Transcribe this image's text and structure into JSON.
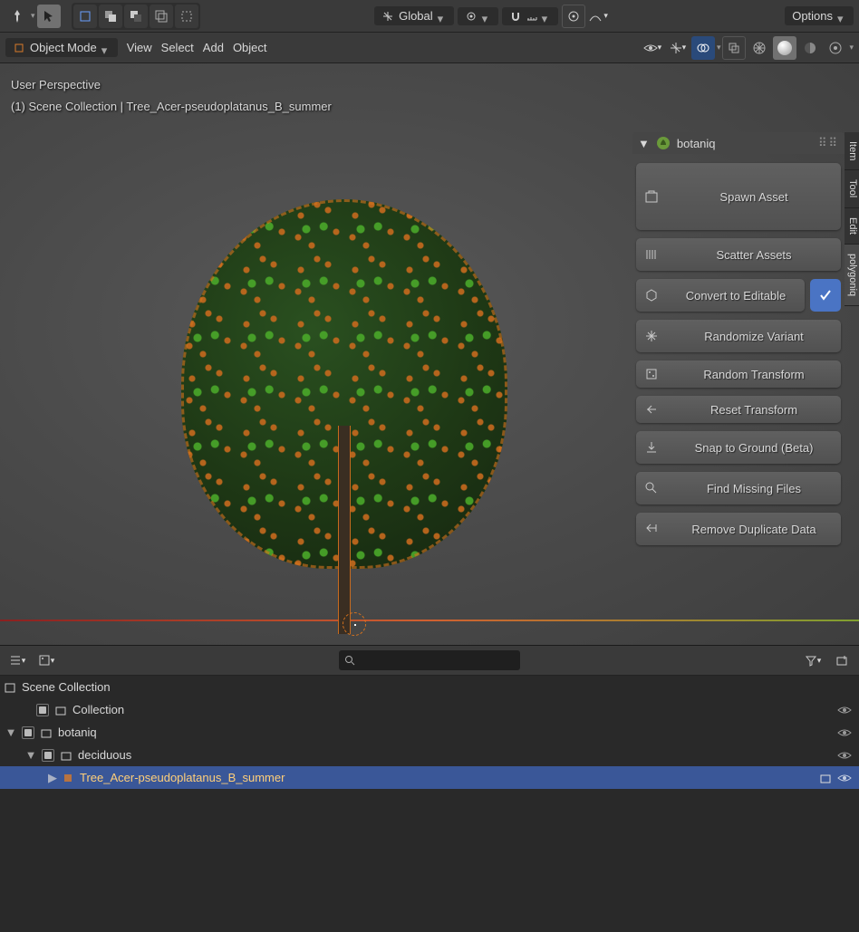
{
  "header": {
    "orientation": "Global",
    "options_label": "Options"
  },
  "toolbar": {
    "mode": "Object Mode",
    "menus": [
      "View",
      "Select",
      "Add",
      "Object"
    ]
  },
  "viewport": {
    "perspective": "User Perspective",
    "scene_line": "(1) Scene Collection | Tree_Acer-pseudoplatanus_B_summer"
  },
  "panel": {
    "title": "botaniq",
    "buttons": {
      "spawn": "Spawn Asset",
      "scatter": "Scatter Assets",
      "convert": "Convert to Editable",
      "randomize": "Randomize Variant",
      "random_tf": "Random Transform",
      "reset_tf": "Reset Transform",
      "snap": "Snap to Ground (Beta)",
      "find": "Find Missing Files",
      "remove": "Remove Duplicate Data"
    }
  },
  "side_tabs": [
    "Item",
    "Tool",
    "Edit",
    "polygoniq"
  ],
  "outliner": {
    "root": "Scene Collection",
    "rows": [
      {
        "name": "Collection",
        "depth": 1,
        "disclosure": "",
        "checkbox": true
      },
      {
        "name": "botaniq",
        "depth": 1,
        "disclosure": "▼",
        "checkbox": true
      },
      {
        "name": "deciduous",
        "depth": 2,
        "disclosure": "▼",
        "checkbox": true
      },
      {
        "name": "Tree_Acer-pseudoplatanus_B_summer",
        "depth": 3,
        "disclosure": "▶",
        "checkbox": false,
        "selected": true
      }
    ]
  }
}
